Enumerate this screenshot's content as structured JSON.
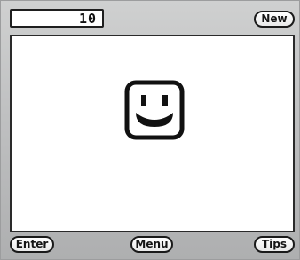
{
  "display": {
    "value": "10"
  },
  "top_bar": {
    "new_label": "New"
  },
  "bottom_bar": {
    "enter_label": "Enter",
    "menu_label": "Menu",
    "tips_label": "Tips"
  },
  "screen": {
    "icon": "smiley-face-icon"
  },
  "colors": {
    "frame": "#bfc0c1",
    "screen": "#ffffff",
    "ink": "#111111"
  }
}
